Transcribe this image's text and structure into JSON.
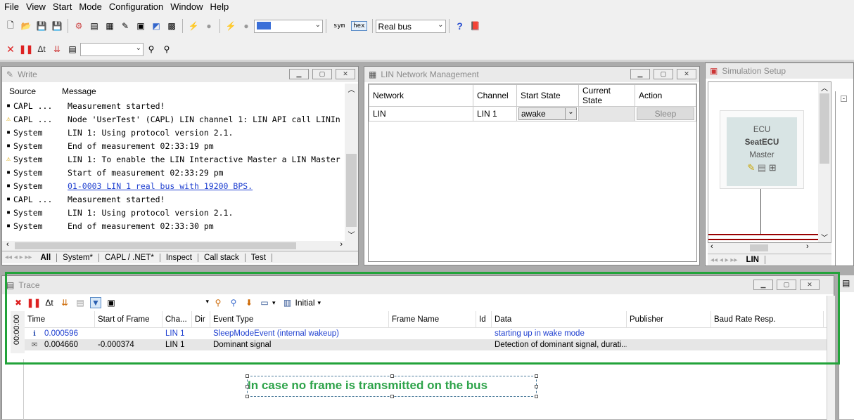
{
  "menu": [
    "File",
    "View",
    "Start",
    "Mode",
    "Configuration",
    "Window",
    "Help"
  ],
  "toolbar": {
    "bus_combo": "Real bus",
    "sym_label": "sym",
    "hex_label": "hex"
  },
  "write": {
    "title": "Write",
    "col_source": "Source",
    "col_message": "Message",
    "rows": [
      {
        "icon": "dot",
        "source": "CAPL ...",
        "message": "Measurement started!"
      },
      {
        "icon": "warn",
        "source": "CAPL ...",
        "message": "Node 'UserTest' (CAPL) LIN channel 1: LIN API call LINIn"
      },
      {
        "icon": "dot",
        "source": "System",
        "message": "LIN 1: Using protocol version 2.1."
      },
      {
        "icon": "dot",
        "source": "System",
        "message": "End of measurement 02:33:19 pm"
      },
      {
        "icon": "warn",
        "source": "System",
        "message": "LIN 1: To enable the LIN Interactive Master a LIN Master"
      },
      {
        "icon": "dot",
        "source": "System",
        "message": "Start of measurement 02:33:29 pm"
      },
      {
        "icon": "dot",
        "source": "System",
        "message": "01-0003 LIN 1   real bus with 19200 BPS.",
        "link": true
      },
      {
        "icon": "dot",
        "source": "CAPL ...",
        "message": "Measurement started!"
      },
      {
        "icon": "dot",
        "source": "System",
        "message": "LIN 1: Using protocol version 2.1."
      },
      {
        "icon": "dot",
        "source": "System",
        "message": "End of measurement 02:33:30 pm"
      }
    ],
    "tabs": [
      "All",
      "System*",
      "CAPL / .NET*",
      "Inspect",
      "Call stack",
      "Test"
    ]
  },
  "lin": {
    "title": "LIN Network Management",
    "headers": [
      "Network",
      "Channel",
      "Start State",
      "Current State",
      "Action"
    ],
    "row": {
      "network": "LIN",
      "channel": "LIN 1",
      "start_state": "awake",
      "current_state": "",
      "action": "Sleep"
    }
  },
  "sim": {
    "title": "Simulation Setup",
    "ecu_label": "ECU",
    "ecu_name": "SeatECU",
    "ecu_role": "Master",
    "tab": "LIN"
  },
  "trace": {
    "title": "Trace",
    "filter_label": "Initial",
    "side_time": "00:00:00",
    "headers": [
      "Time",
      "Start of Frame",
      "Cha...",
      "Dir",
      "Event Type",
      "Frame Name",
      "Id",
      "Data",
      "Publisher",
      "Baud Rate Resp."
    ],
    "rows": [
      {
        "time": "0.000596",
        "sof": "",
        "channel": "LIN 1",
        "dir": "",
        "event": "SleepModeEvent (internal wakeup)",
        "frame": "",
        "id": "",
        "data": "starting up in wake mode",
        "blue": true
      },
      {
        "time": "0.004660",
        "sof": "-0.000374",
        "channel": "LIN 1",
        "dir": "",
        "event": "Dominant signal",
        "frame": "",
        "id": "",
        "data": "Detection of dominant signal, durati...",
        "blue": false
      }
    ]
  },
  "annotation": {
    "text": "In case no frame is transmitted on the bus",
    "color": "#2ea34a"
  }
}
